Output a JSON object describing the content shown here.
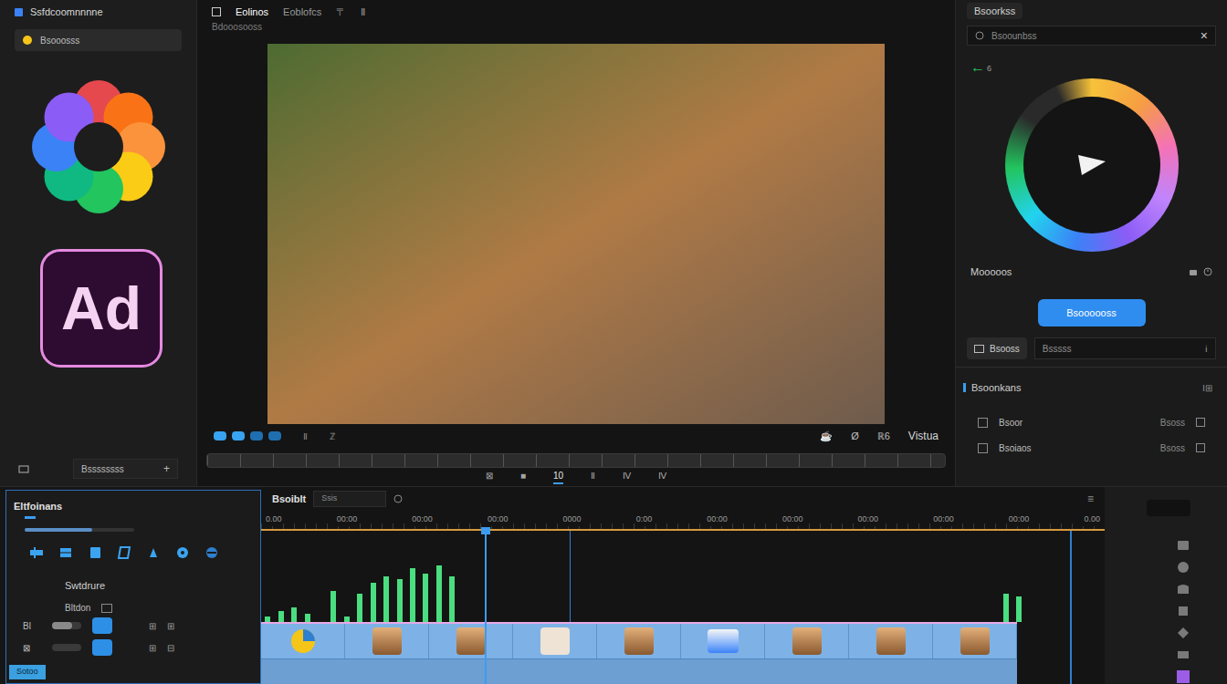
{
  "left_panel": {
    "title": "Ssfdcoomnnnne",
    "dropdown": "Bsooosss",
    "logo": "Ad",
    "footer": {
      "label": "Bssssssss",
      "action": "+"
    }
  },
  "viewer": {
    "tabs": [
      {
        "label": "Eolinos",
        "selected": true
      },
      {
        "label": "Eoblofcs",
        "selected": false
      },
      {
        "label": "〒",
        "selected": false
      },
      {
        "label": "Ⅱ",
        "selected": false
      }
    ],
    "subtitle": "Bdooosooss",
    "view_buttons": [
      {
        "selected": true
      },
      {
        "selected": true
      },
      {
        "selected": false
      },
      {
        "selected": false
      }
    ],
    "control_marks": [
      "Ⅱ",
      "ℤ"
    ],
    "right_controls": [
      "☕",
      "Ø",
      "ℝ6",
      "Vistua"
    ],
    "transport": [
      {
        "label": "⊠",
        "selected": false
      },
      {
        "label": "■",
        "selected": false
      },
      {
        "label": "10",
        "selected": true
      },
      {
        "label": "Ⅱ",
        "selected": false
      },
      {
        "label": "Ⅳ",
        "selected": false
      },
      {
        "label": "Ⅳ",
        "selected": false
      }
    ]
  },
  "inspector": {
    "title": "Bsoorkss",
    "search_placeholder": "Bsoounbss",
    "close": "×",
    "back": "←",
    "back_count": "6",
    "mode_label": "Mooooos",
    "apply_button": "Bsoooooss",
    "field_button": "Bsooss",
    "field_value": "Bsssss",
    "field_end": "ℹ",
    "section": {
      "title": "Bsoonkans",
      "tools": "Ⅰ⊞",
      "rows": [
        {
          "label": "Bsoor",
          "value": "Bsoss"
        },
        {
          "label": "Bsoiaos",
          "value": "Bsoss"
        }
      ]
    }
  },
  "effects": {
    "title": "Eltfoinans",
    "meter": {
      "level": 0.62
    },
    "section": "Swtdrure",
    "group": "Bltdon",
    "rows": [
      {
        "label": "Bl",
        "level": 0.7,
        "values": [
          "⊞",
          "⊞"
        ]
      },
      {
        "label": "⊠",
        "level": 0.0,
        "values": [
          "⊞",
          "⊟"
        ]
      }
    ],
    "badge": "Sotoo"
  },
  "timeline": {
    "title": "Bsoiblt",
    "field": "Ssis",
    "menu": "≡",
    "ruler": [
      "0.00",
      "00:00",
      "00:00",
      "00:00",
      "0000",
      "0:00",
      "00:00",
      "00:00",
      "00:00",
      "00:00",
      "00:00",
      "0.00"
    ],
    "playhead": {
      "level": 0.265
    },
    "peaks": [
      0.1,
      0.2,
      0.25,
      0.15,
      0,
      0.55,
      0.1,
      0.5,
      0.7,
      0.8,
      0.75,
      0.95,
      0.85,
      1.0,
      0.8,
      0,
      0,
      0,
      0,
      0,
      0,
      0,
      0,
      0,
      0,
      0,
      0,
      0,
      0,
      0,
      0,
      0,
      0,
      0,
      0,
      0,
      0,
      0,
      0,
      0,
      0,
      0,
      0,
      0,
      0,
      0,
      0,
      0,
      0,
      0,
      0,
      0,
      0,
      0,
      0,
      0,
      0.5,
      0.45,
      0,
      0,
      0,
      0,
      0,
      0
    ],
    "clips": [
      {
        "kind": "badge"
      },
      {
        "kind": "cat"
      },
      {
        "kind": "cat"
      },
      {
        "kind": "photo"
      },
      {
        "kind": "cat"
      },
      {
        "kind": "screen"
      },
      {
        "kind": "cat"
      },
      {
        "kind": "cat"
      },
      {
        "kind": "cat"
      }
    ]
  }
}
